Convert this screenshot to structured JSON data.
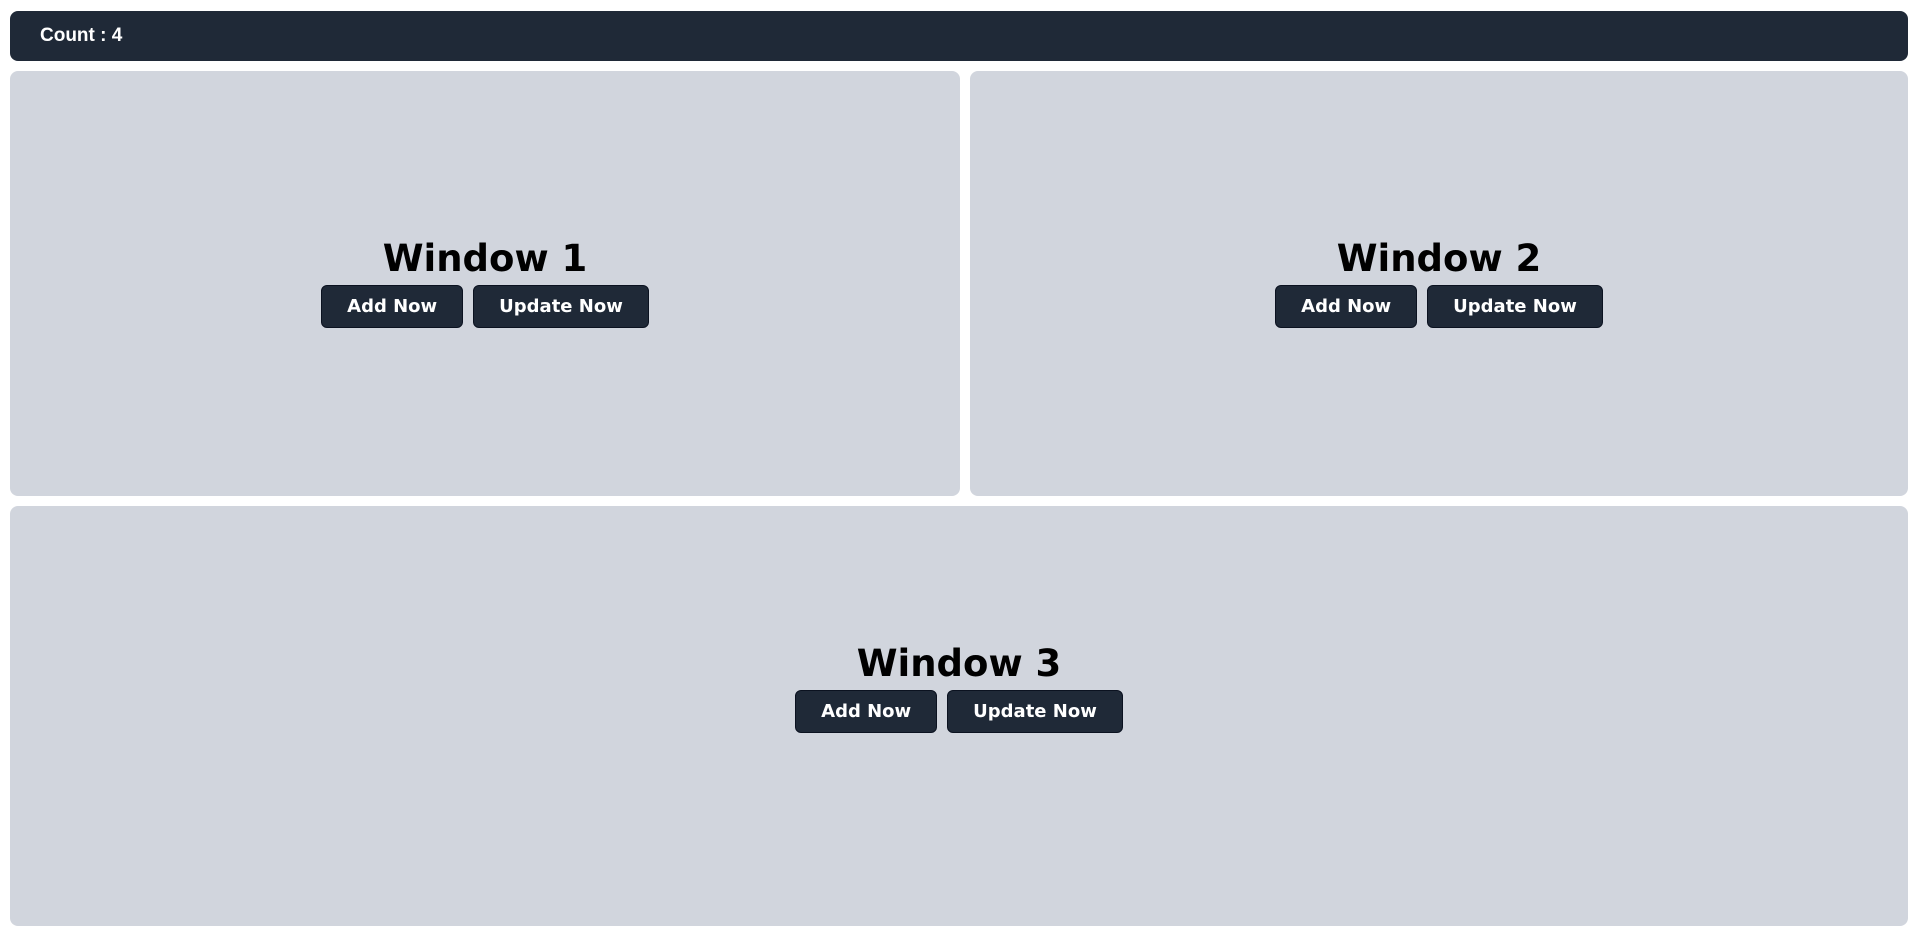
{
  "header": {
    "count_label": "Count : 4"
  },
  "windows": [
    {
      "title": "Window 1",
      "add_label": "Add Now",
      "update_label": "Update Now"
    },
    {
      "title": "Window 2",
      "add_label": "Add Now",
      "update_label": "Update Now"
    },
    {
      "title": "Window 3",
      "add_label": "Add Now",
      "update_label": "Update Now"
    }
  ],
  "colors": {
    "header_bg": "#1f2937",
    "panel_bg": "#d1d5dd",
    "button_bg": "#1f2937"
  }
}
